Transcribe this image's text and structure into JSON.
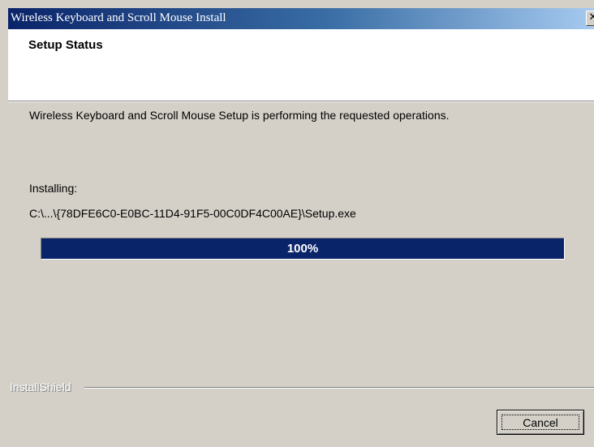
{
  "window": {
    "title": "Wireless Keyboard and Scroll Mouse Install",
    "close_glyph": "✕"
  },
  "header": {
    "title": "Setup Status"
  },
  "body": {
    "status_message": "Wireless Keyboard and Scroll Mouse Setup is performing the requested operations.",
    "installing_label": "Installing:",
    "file_path": "C:\\...\\{78DFE6C0-E0BC-11D4-91F5-00C0DF4C00AE}\\Setup.exe"
  },
  "progress": {
    "percent": 100,
    "label": "100%",
    "fill_color": "#0a246a"
  },
  "footer": {
    "brand": "InstallShield",
    "cancel_label": "Cancel"
  },
  "colors": {
    "titlebar_start": "#0a246a",
    "titlebar_end": "#a6caf0",
    "dialog_face": "#d4d0c8"
  },
  "icons": {
    "close": "close-icon"
  }
}
